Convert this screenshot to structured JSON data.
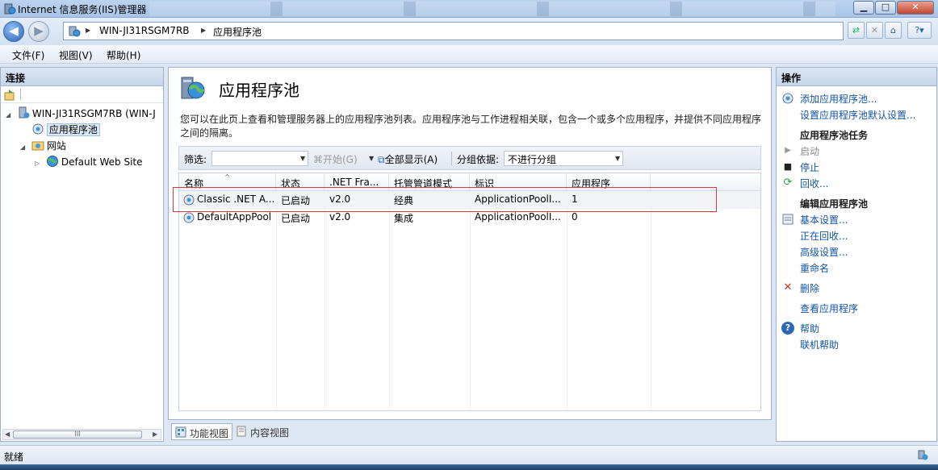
{
  "window": {
    "title": "Internet 信息服务(IIS)管理器"
  },
  "address": {
    "server": "WIN-JI31RSGM7RB",
    "page": "应用程序池"
  },
  "menu": {
    "file": "文件(F)",
    "view": "视图(V)",
    "help": "帮助(H)"
  },
  "connections": {
    "header": "连接",
    "tree": {
      "server": "WIN-JI31RSGM7RB (WIN-J",
      "app_pools": "应用程序池",
      "sites": "网站",
      "default_site": "Default Web Site"
    },
    "scroll_label": "III"
  },
  "main": {
    "title": "应用程序池",
    "description": "您可以在此页上查看和管理服务器上的应用程序池列表。应用程序池与工作进程相关联，包含一个或多个应用程序，并提供不同应用程序之间的隔离。",
    "filter": {
      "label": "筛选:",
      "start": "开始(G)",
      "show_all": "全部显示(A)",
      "group_label": "分组依据:",
      "group_value": "不进行分组"
    },
    "columns": [
      "名称",
      "状态",
      ".NET Fra...",
      "托管管道模式",
      "标识",
      "应用程序"
    ],
    "rows": [
      [
        "Classic .NET A...",
        "已启动",
        "v2.0",
        "经典",
        "ApplicationPoolI...",
        "1"
      ],
      [
        "DefaultAppPool",
        "已启动",
        "v2.0",
        "集成",
        "ApplicationPoolI...",
        "0"
      ]
    ],
    "view_tabs": {
      "features": "功能视图",
      "content": "内容视图"
    }
  },
  "actions": {
    "header": "操作",
    "add_pool": "添加应用程序池...",
    "set_defaults": "设置应用程序池默认设置...",
    "task_header": "应用程序池任务",
    "start": "启动",
    "stop": "停止",
    "recycle": "回收...",
    "edit_header": "编辑应用程序池",
    "basic": "基本设置...",
    "recycling": "正在回收...",
    "advanced": "高级设置...",
    "rename": "重命名",
    "delete": "删除",
    "view_apps": "查看应用程序",
    "help": "帮助",
    "online_help": "联机帮助"
  },
  "status": {
    "text": "就绪"
  },
  "colors": {
    "accent_link": "#1255a8",
    "highlight_border": "#d43a3a"
  }
}
